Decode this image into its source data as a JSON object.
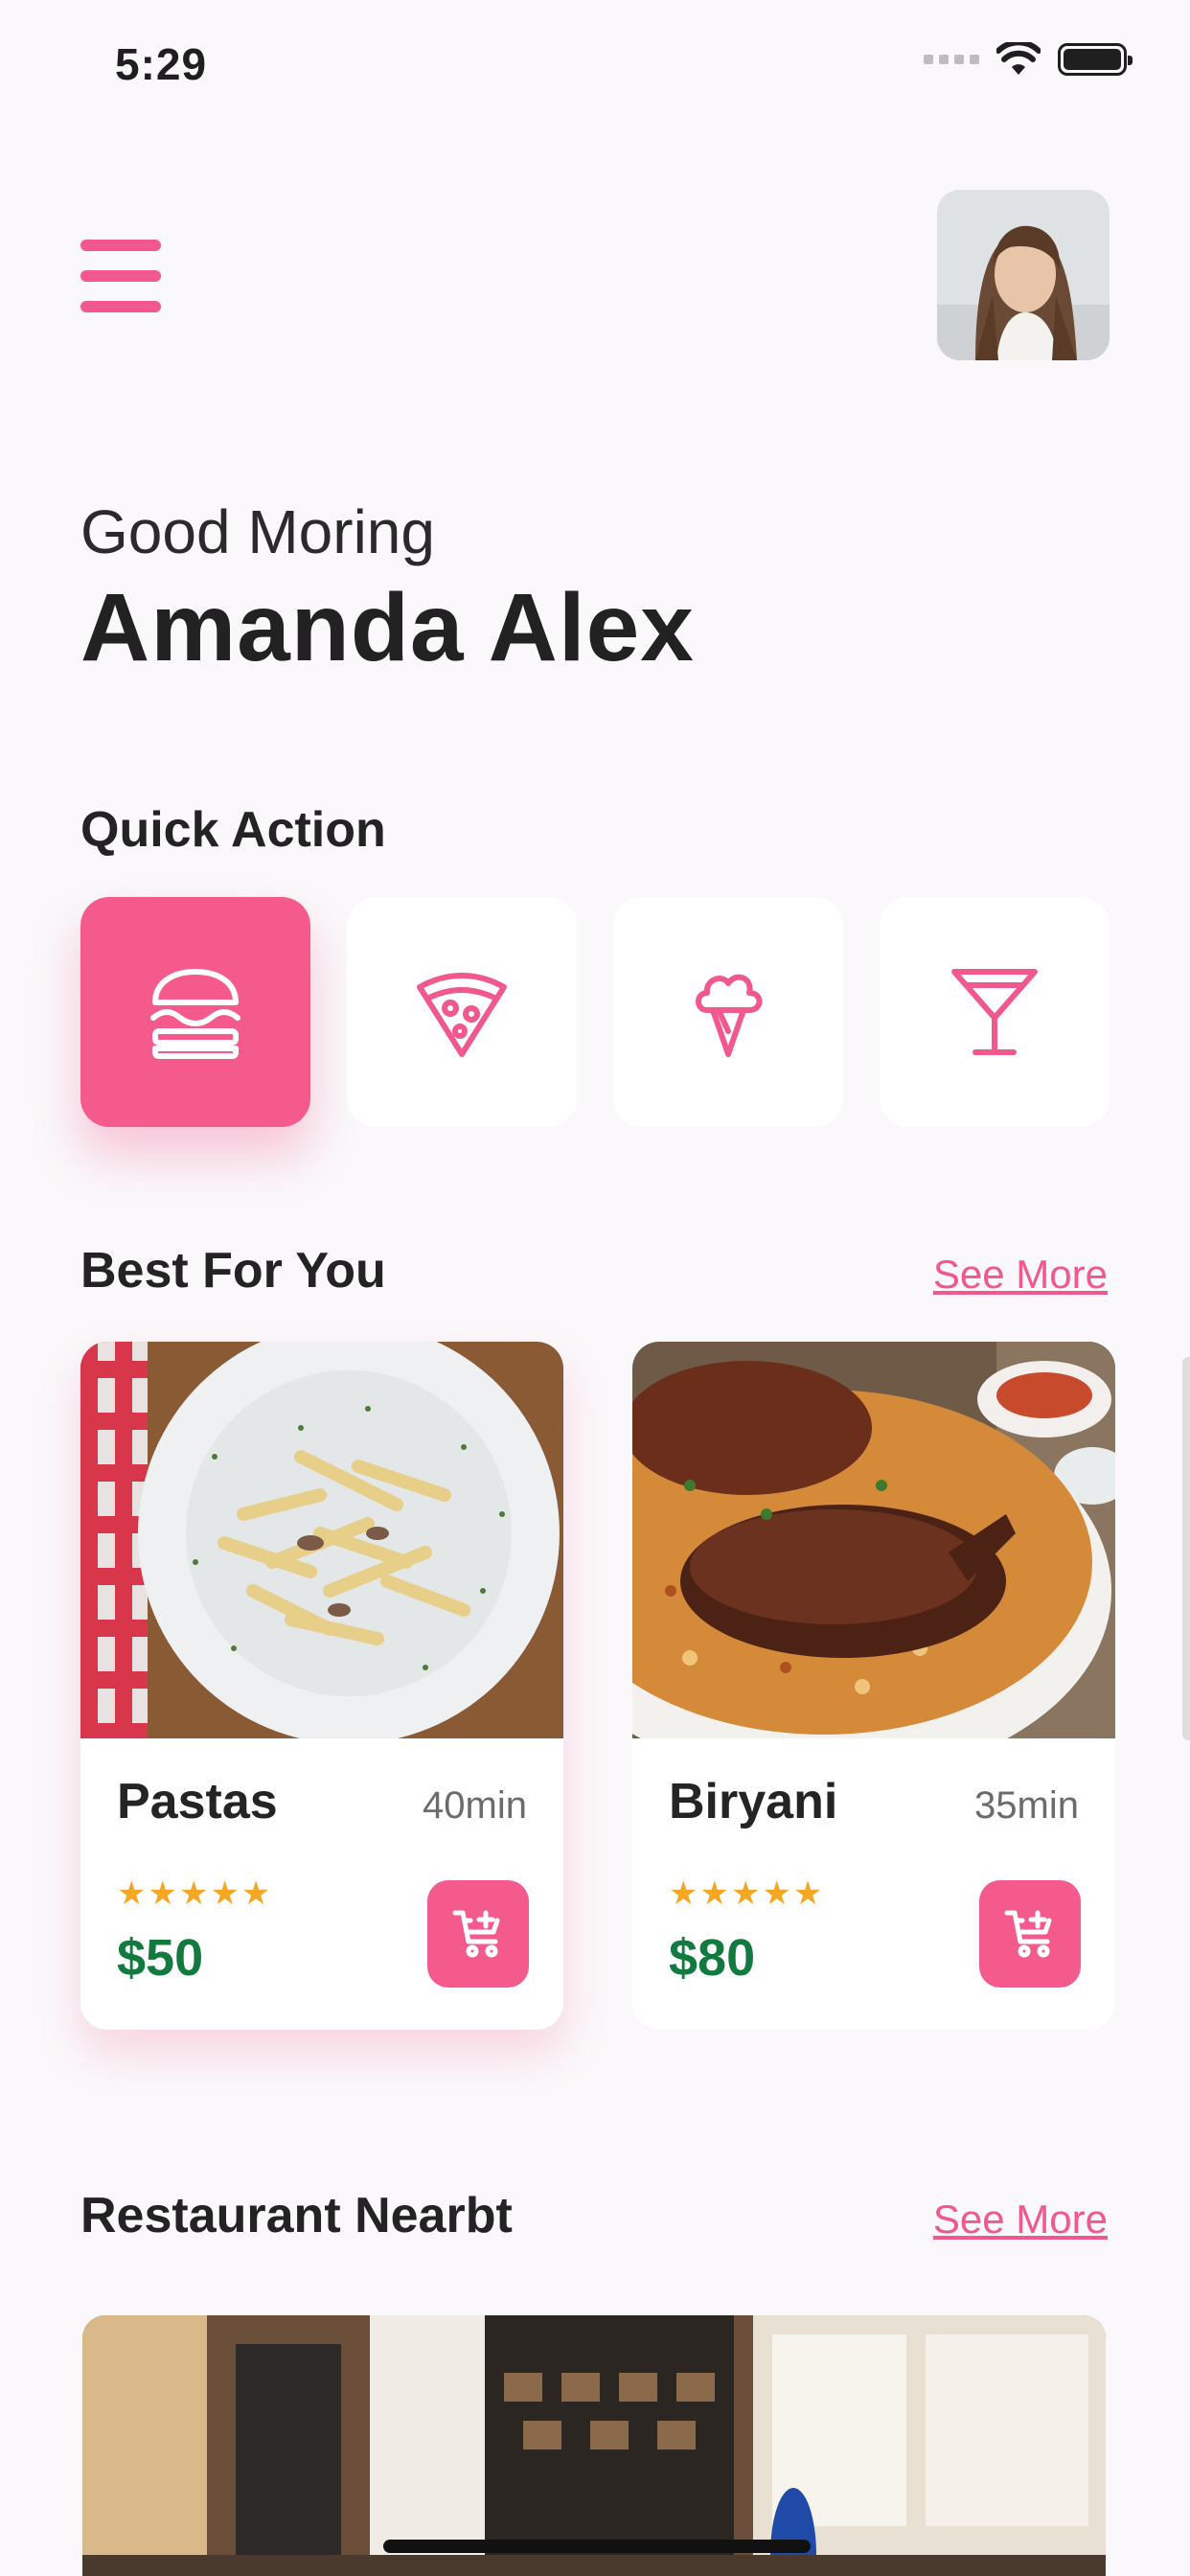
{
  "status_bar": {
    "time": "5:29"
  },
  "header": {
    "menu_icon": "hamburger-icon",
    "avatar": "user-avatar"
  },
  "greeting": {
    "salutation": "Good Moring",
    "name": "Amanda Alex"
  },
  "quick_action": {
    "title": "Quick Action",
    "items": [
      {
        "icon": "burger-icon",
        "active": true
      },
      {
        "icon": "pizza-icon",
        "active": false
      },
      {
        "icon": "ice-cream-icon",
        "active": false
      },
      {
        "icon": "cocktail-icon",
        "active": false
      }
    ]
  },
  "best_for_you": {
    "title": "Best For You",
    "see_more": "See More",
    "cards": [
      {
        "name": "Pastas",
        "time": "40min",
        "stars": "★★★★★",
        "price": "$50"
      },
      {
        "name": "Biryani",
        "time": "35min",
        "stars": "★★★★★",
        "price": "$80"
      }
    ]
  },
  "restaurant_nearby": {
    "title": "Restaurant Nearbt",
    "see_more": "See More"
  },
  "colors": {
    "accent": "#f45a8c",
    "price": "#127a3e",
    "star": "#f5a623",
    "background": "#faf8fa"
  }
}
